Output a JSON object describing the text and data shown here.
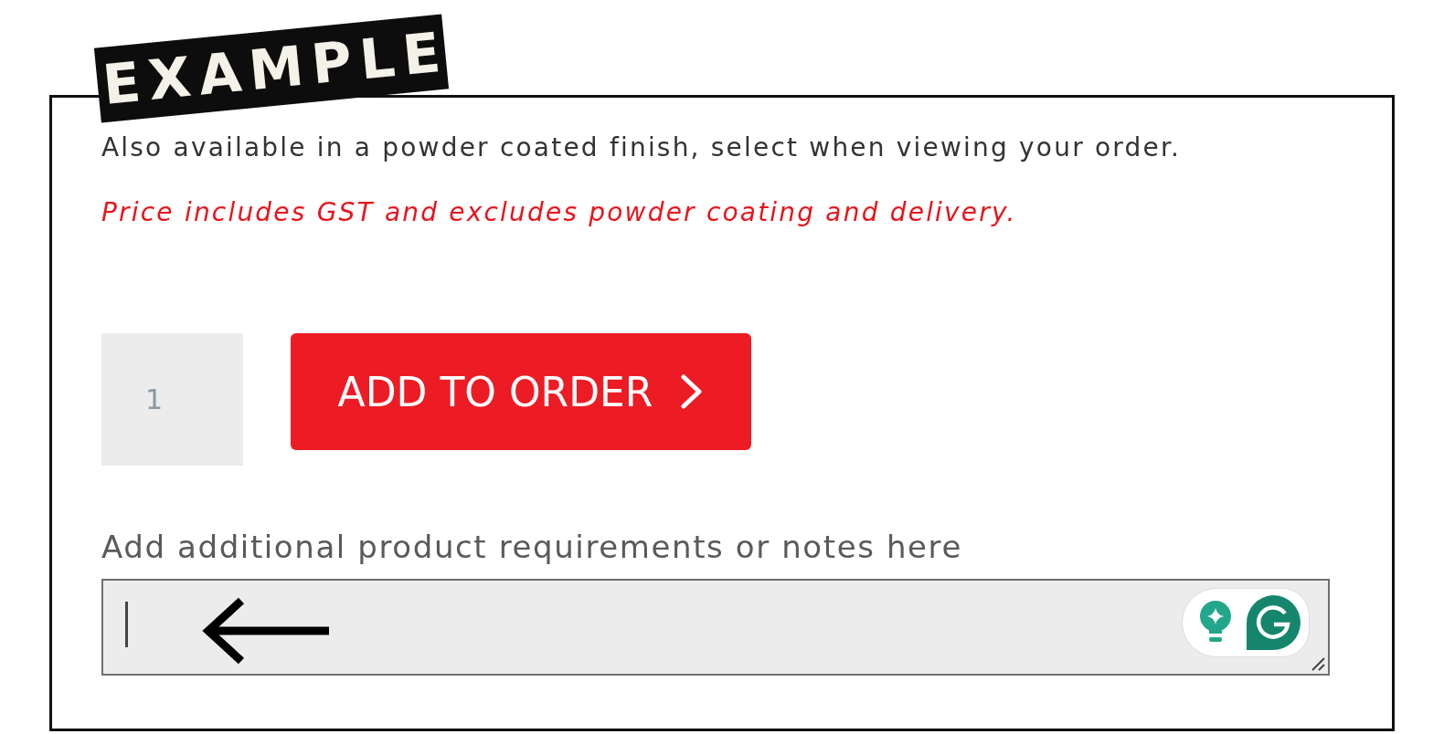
{
  "stamp": {
    "text": "EXAMPLE"
  },
  "product": {
    "finish_note": "Also available in a powder coated finish, select when viewing your order.",
    "price_note": "Price includes GST and excludes powder coating and delivery."
  },
  "order": {
    "quantity": {
      "value": "1"
    },
    "add_button": {
      "label": "ADD TO ORDER"
    }
  },
  "notes": {
    "label": "Add additional product requirements or notes here",
    "field": {
      "focused": true
    }
  }
}
